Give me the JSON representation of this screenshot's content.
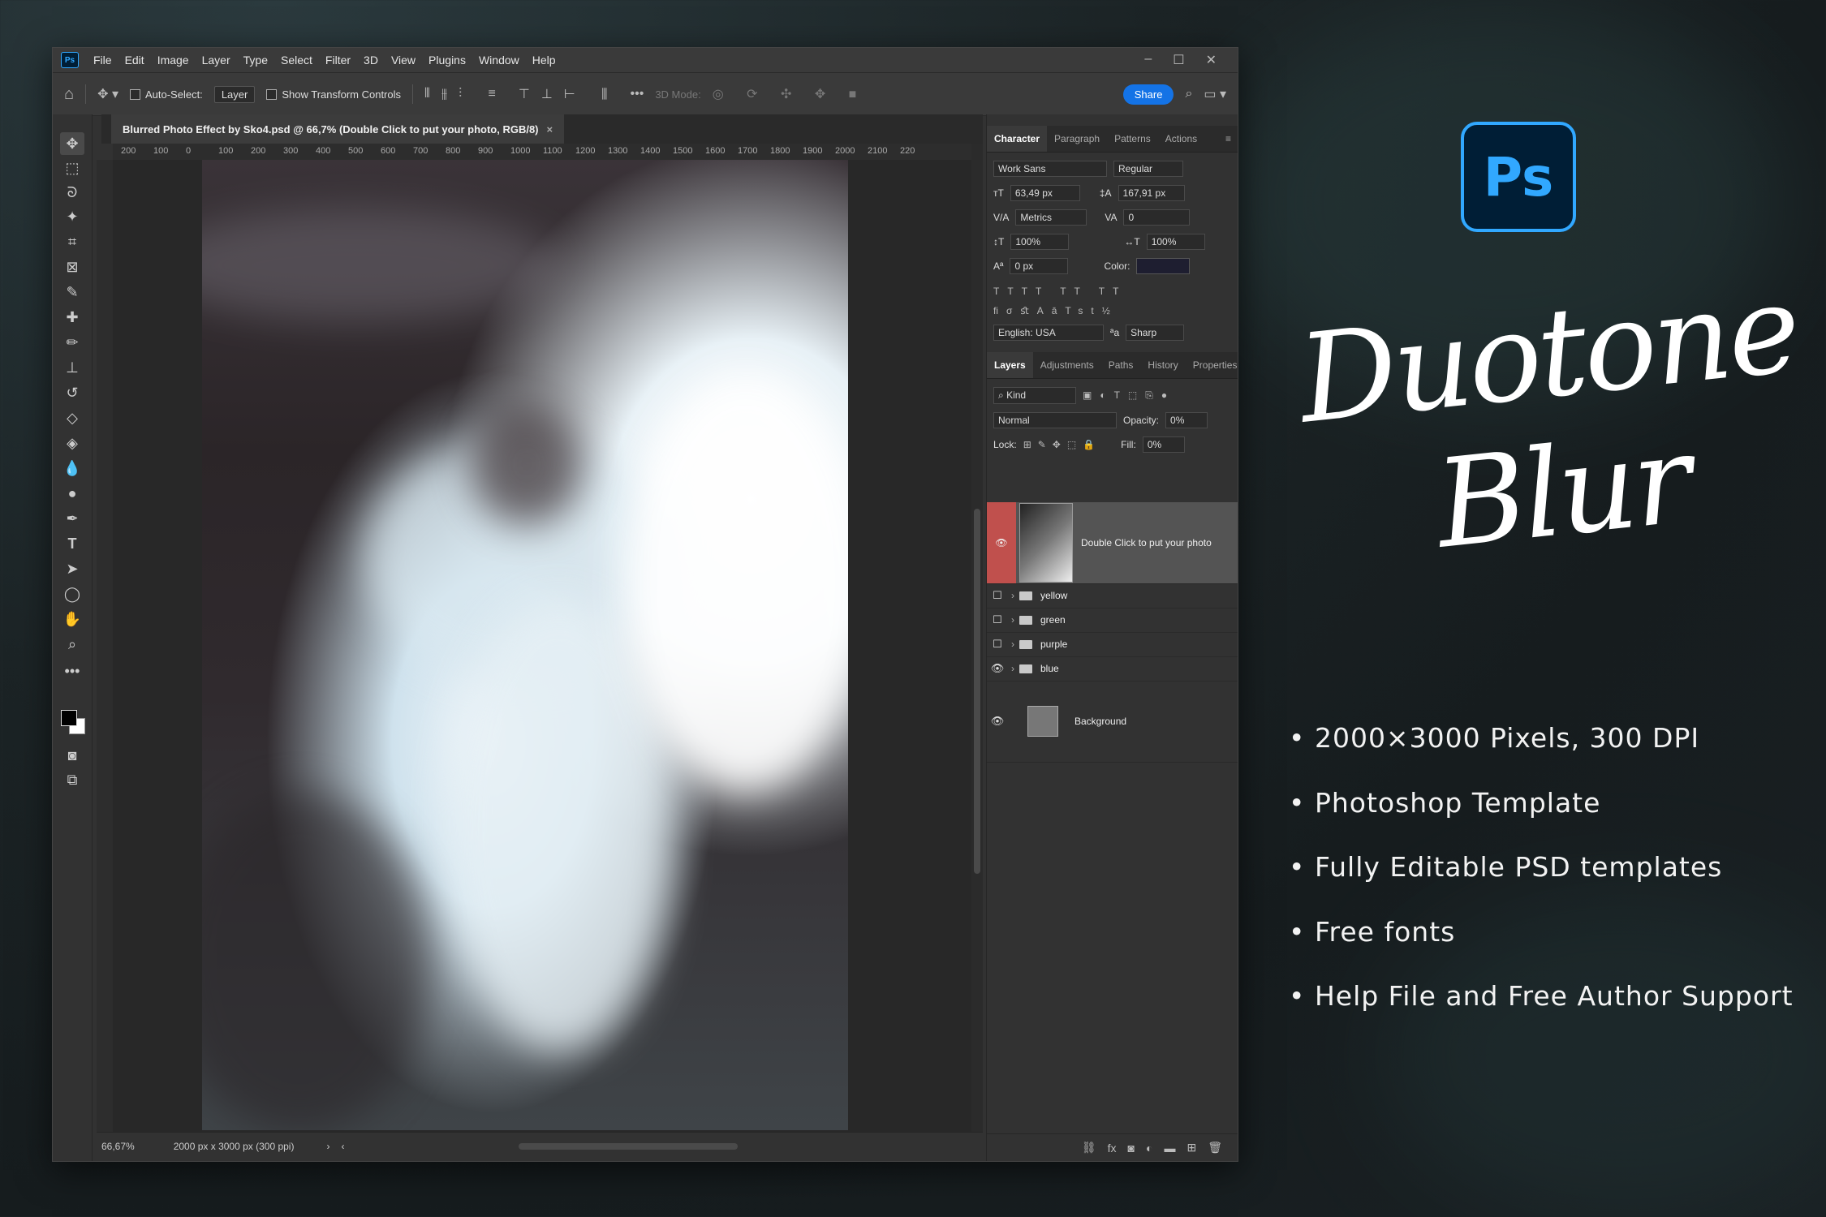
{
  "menu": [
    "File",
    "Edit",
    "Image",
    "Layer",
    "Type",
    "Select",
    "Filter",
    "3D",
    "View",
    "Plugins",
    "Window",
    "Help"
  ],
  "options": {
    "auto_select": "Auto-Select:",
    "layer_dropdown": "Layer",
    "show_transform": "Show Transform Controls",
    "mode_3d": "3D Mode:",
    "share": "Share"
  },
  "document": {
    "tab_title": "Blurred Photo Effect by Sko4.psd @ 66,7% (Double Click to put your photo, RGB/8)",
    "close": "×",
    "zoom": "66,67%",
    "size_info": "2000 px x 3000 px (300 ppi)"
  },
  "ruler_top": [
    "200",
    "100",
    "0",
    "100",
    "200",
    "300",
    "400",
    "500",
    "600",
    "700",
    "800",
    "900",
    "1000",
    "1100",
    "1200",
    "1300",
    "1400",
    "1500",
    "1600",
    "1700",
    "1800",
    "1900",
    "2000",
    "2100",
    "220"
  ],
  "character_panel": {
    "tabs": [
      "Character",
      "Paragraph",
      "Patterns",
      "Actions"
    ],
    "font": "Work Sans",
    "style": "Regular",
    "size": "63,49 px",
    "leading": "167,91 px",
    "kerning": "Metrics",
    "tracking": "0",
    "vscale": "100%",
    "hscale": "100%",
    "baseline": "0 px",
    "color_label": "Color:",
    "color_value": "#1e1e30",
    "language": "English: USA",
    "aa_label": "ªa",
    "antialias": "Sharp"
  },
  "layers_panel": {
    "tabs": [
      "Layers",
      "Adjustments",
      "Paths",
      "History",
      "Properties"
    ],
    "kind": "Kind",
    "blend": "Normal",
    "opacity_label": "Opacity:",
    "opacity": "0%",
    "lock_label": "Lock:",
    "fill_label": "Fill:",
    "fill": "0%",
    "layers": [
      {
        "name": "Double Click to put your photo",
        "visible": true,
        "type": "smart"
      },
      {
        "name": "yellow",
        "visible": false,
        "type": "group"
      },
      {
        "name": "green",
        "visible": false,
        "type": "group"
      },
      {
        "name": "purple",
        "visible": false,
        "type": "group"
      },
      {
        "name": "blue",
        "visible": true,
        "type": "group"
      },
      {
        "name": "Background",
        "visible": true,
        "type": "pixel"
      }
    ]
  },
  "promo": {
    "logo": "Ps",
    "title_line1": "Duotone",
    "title_line2": "Blur",
    "features": [
      "• 2000×3000 Pixels, 300 DPI",
      "• Photoshop Template",
      "• Fully Editable PSD templates",
      "• Free fonts",
      "• Help File and Free Author Support"
    ]
  }
}
